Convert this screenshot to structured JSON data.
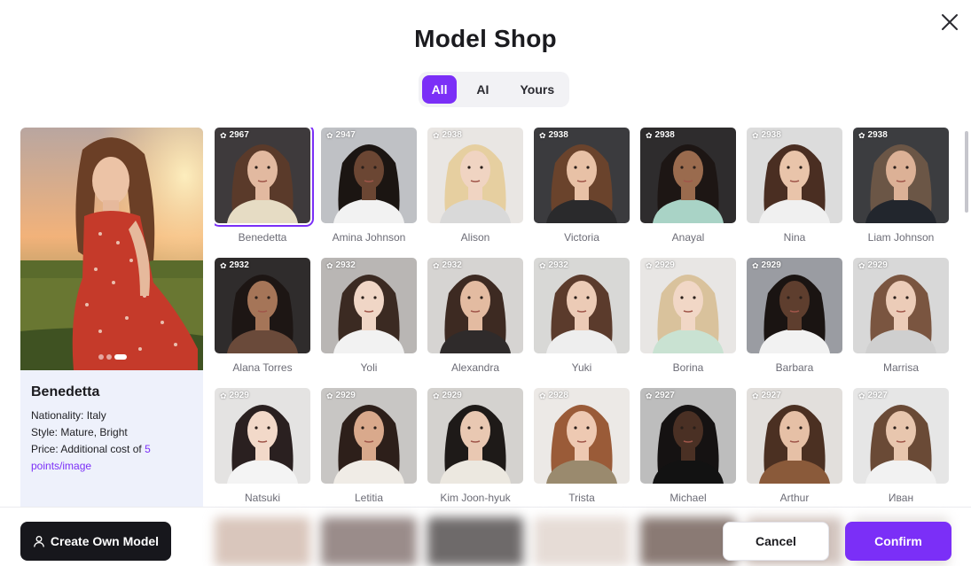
{
  "header": {
    "title": "Model Shop"
  },
  "tabs": [
    {
      "label": "All",
      "active": true
    },
    {
      "label": "AI",
      "active": false
    },
    {
      "label": "Yours",
      "active": false
    }
  ],
  "preview": {
    "name": "Benedetta",
    "nationality": "Nationality: Italy",
    "style": "Style: Mature, Bright",
    "price_prefix": "Price: Additional cost of ",
    "price_link": "5 points/image",
    "carousel_total": 3,
    "carousel_active": 3
  },
  "models": [
    {
      "name": "Benedetta",
      "count": "2967",
      "selected": true,
      "bg": "#3e3a3c",
      "skin": "#e2b9a0",
      "hair": "#5a3a2a",
      "top": "#e6dcc4"
    },
    {
      "name": "Amina Johnson",
      "count": "2947",
      "bg": "#bfc1c5",
      "skin": "#6b4633",
      "hair": "#1b1512",
      "top": "#f2f2f2"
    },
    {
      "name": "Alison",
      "count": "2938",
      "bg": "#e9e6e3",
      "skin": "#f0d4c2",
      "hair": "#e6cfa0",
      "top": "#d9d9d9"
    },
    {
      "name": "Victoria",
      "count": "2938",
      "bg": "#3b3b3e",
      "skin": "#e8c1a6",
      "hair": "#6a432c",
      "top": "#2a2a2c"
    },
    {
      "name": "Anayal",
      "count": "2938",
      "bg": "#2e2c2d",
      "skin": "#9a6b4e",
      "hair": "#1d1614",
      "top": "#a9d3c6"
    },
    {
      "name": "Nina",
      "count": "2938",
      "bg": "#dcdcdc",
      "skin": "#e9c4aa",
      "hair": "#4a2e22",
      "top": "#f0f0f0"
    },
    {
      "name": "Liam Johnson",
      "count": "2938",
      "bg": "#3c3d40",
      "skin": "#dcb196",
      "hair": "#6b5646",
      "top": "#22262d"
    },
    {
      "name": "Alana Torres",
      "count": "2932",
      "bg": "#2f2c2c",
      "skin": "#a57558",
      "hair": "#1d1614",
      "top": "#6a4a3a"
    },
    {
      "name": "Yoli",
      "count": "2932",
      "bg": "#b9b6b4",
      "skin": "#f0d6c6",
      "hair": "#3b2a22",
      "top": "#f2f2f2"
    },
    {
      "name": "Alexandra",
      "count": "2932",
      "bg": "#d6d4d2",
      "skin": "#e3bba1",
      "hair": "#3d2a22",
      "top": "#2f2b2b"
    },
    {
      "name": "Yuki",
      "count": "2932",
      "bg": "#d8d8d6",
      "skin": "#eccbb6",
      "hair": "#5b3b2c",
      "top": "#eeeeee"
    },
    {
      "name": "Borina",
      "count": "2929",
      "bg": "#e8e6e4",
      "skin": "#f1d7c6",
      "hair": "#d9c29c",
      "top": "#c9e2d2"
    },
    {
      "name": "Barbara",
      "count": "2929",
      "bg": "#9a9ca2",
      "skin": "#5e3e2e",
      "hair": "#1a1412",
      "top": "#f2f2f2"
    },
    {
      "name": "Marrisa",
      "count": "2929",
      "bg": "#d8d8d8",
      "skin": "#ecccb8",
      "hair": "#7a5540",
      "top": "#cfcfcf"
    },
    {
      "name": "Natsuki",
      "count": "2929",
      "bg": "#e4e3e2",
      "skin": "#f2d9c9",
      "hair": "#2a2020",
      "top": "#f4f4f4"
    },
    {
      "name": "Letitia",
      "count": "2929",
      "bg": "#c8c6c4",
      "skin": "#d9a98c",
      "hair": "#2d1f1a",
      "top": "#f0ece6"
    },
    {
      "name": "Kim Joon-hyuk",
      "count": "2929",
      "bg": "#d4d2cf",
      "skin": "#e9c8b2",
      "hair": "#1e1a18",
      "top": "#ece8e0"
    },
    {
      "name": "Trista",
      "count": "2928",
      "bg": "#ece9e6",
      "skin": "#eec9b2",
      "hair": "#9a5b38",
      "top": "#9a8a6e"
    },
    {
      "name": "Michael",
      "count": "2927",
      "bg": "#bdbdbd",
      "skin": "#4a3024",
      "hair": "#151212",
      "top": "#121212"
    },
    {
      "name": "Arthur",
      "count": "2927",
      "bg": "#e2dfdc",
      "skin": "#e6c0a6",
      "hair": "#4b3022",
      "top": "#8a5a3a"
    },
    {
      "name": "Иван",
      "count": "2927",
      "bg": "#e6e6e6",
      "skin": "#e8c6ae",
      "hair": "#6a4a36",
      "top": "#f2f2f2"
    }
  ],
  "footer": {
    "create_label": "Create Own Model",
    "cancel_label": "Cancel",
    "confirm_label": "Confirm"
  },
  "colors": {
    "accent": "#7b2ff7",
    "dark_button": "#17171c"
  },
  "icons": {
    "close": "close-icon",
    "flame": "flame-icon",
    "person": "person-icon"
  }
}
